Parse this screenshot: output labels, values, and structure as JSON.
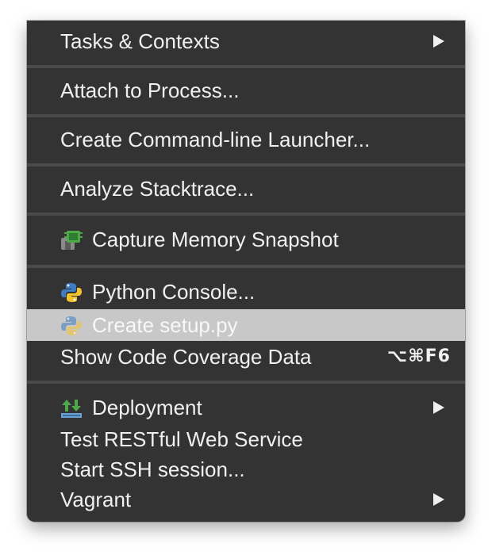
{
  "menu": {
    "items": [
      {
        "label": "Tasks & Contexts",
        "submenu": true
      },
      {
        "label": "Attach to Process..."
      },
      {
        "label": "Create Command-line Launcher..."
      },
      {
        "label": "Analyze Stacktrace..."
      },
      {
        "label": "Capture Memory Snapshot",
        "icon": "memory-snapshot-icon"
      },
      {
        "label": "Python Console...",
        "icon": "python-icon"
      },
      {
        "label": "Create setup.py",
        "icon": "python-icon",
        "disabled": true
      },
      {
        "label": "Show Code Coverage Data",
        "shortcut": "⌥⌘F6"
      },
      {
        "label": "Deployment",
        "icon": "deployment-icon",
        "submenu": true
      },
      {
        "label": "Test RESTful Web Service"
      },
      {
        "label": "Start SSH session..."
      },
      {
        "label": "Vagrant",
        "submenu": true
      }
    ]
  },
  "colors": {
    "menu_background": "#333333",
    "separator": "#4a4a4a",
    "highlight": "#c8c8c8",
    "text": "#f0f0f0"
  }
}
